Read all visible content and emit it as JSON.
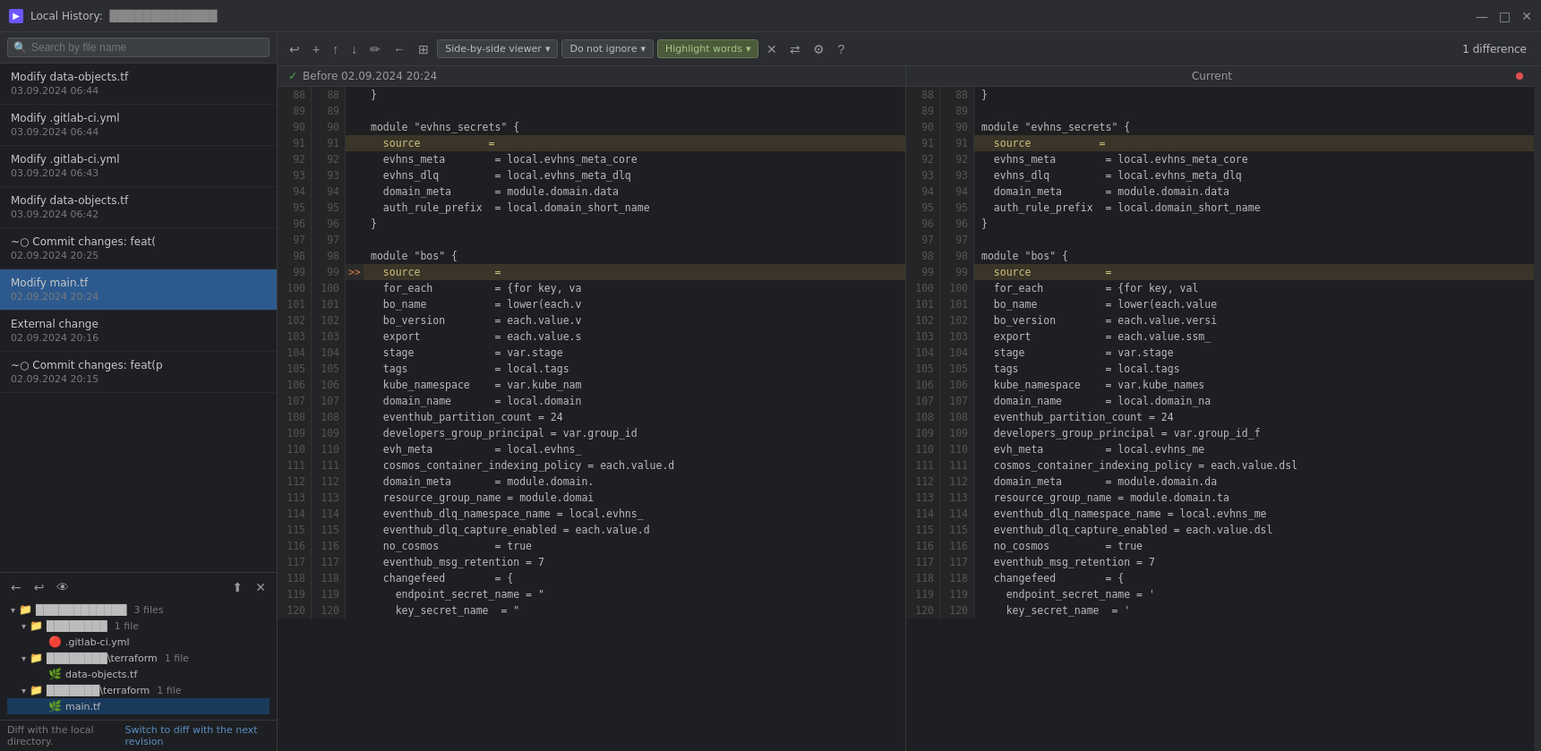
{
  "titleBar": {
    "icon": "▶",
    "title": "Local History:",
    "projectName": "█████████████",
    "windowControls": [
      "—",
      "□",
      "✕"
    ]
  },
  "search": {
    "placeholder": "Search by file name"
  },
  "historyItems": [
    {
      "id": 1,
      "title": "Modify data-objects.tf",
      "date": "03.09.2024 06:44"
    },
    {
      "id": 2,
      "title": "Modify .gitlab-ci.yml",
      "date": "03.09.2024 06:44"
    },
    {
      "id": 3,
      "title": "Modify .gitlab-ci.yml",
      "date": "03.09.2024 06:43"
    },
    {
      "id": 4,
      "title": "Modify data-objects.tf",
      "date": "03.09.2024 06:42"
    },
    {
      "id": 5,
      "title": "~○ Commit changes: feat(",
      "date": "02.09.2024 20:25",
      "hasHash": true
    },
    {
      "id": 6,
      "title": "Modify main.tf",
      "date": "02.09.2024 20:24",
      "selected": true
    },
    {
      "id": 7,
      "title": "External change",
      "date": "02.09.2024 20:16"
    },
    {
      "id": 8,
      "title": "~○ Commit changes: feat(p",
      "date": "02.09.2024 20:15",
      "hasHash": true
    }
  ],
  "treeItems": [
    {
      "id": 1,
      "label": "████████████",
      "count": "3 files",
      "indent": 0,
      "type": "folder",
      "expanded": true
    },
    {
      "id": 2,
      "label": "████████",
      "count": "1 file",
      "indent": 1,
      "type": "folder",
      "expanded": true
    },
    {
      "id": 3,
      "label": ".gitlab-ci.yml",
      "count": "",
      "indent": 2,
      "type": "yaml"
    },
    {
      "id": 4,
      "label": "████████\\terraform",
      "count": "1 file",
      "indent": 1,
      "type": "folder",
      "expanded": true
    },
    {
      "id": 5,
      "label": "data-objects.tf",
      "count": "",
      "indent": 2,
      "type": "tf"
    },
    {
      "id": 6,
      "label": "███████\\terraform",
      "count": "1 file",
      "indent": 1,
      "type": "folder",
      "expanded": true
    },
    {
      "id": 7,
      "label": "main.tf",
      "count": "",
      "indent": 2,
      "type": "tf",
      "selected": true
    }
  ],
  "diffFooter": {
    "text": "Diff with the local directory.",
    "linkText": "Switch to diff with the next revision"
  },
  "toolbar": {
    "diffCount": "1 difference",
    "viewerMode": "Side-by-side viewer",
    "ignoreMode": "Do not ignore",
    "highlightMode": "Highlight words"
  },
  "leftPane": {
    "header": "Before 02.09.2024 20:24"
  },
  "rightPane": {
    "header": "Current"
  },
  "codeLines": [
    {
      "num": 88,
      "content": "}"
    },
    {
      "num": 89,
      "content": ""
    },
    {
      "num": 90,
      "content": "module \"evhns_secrets\" {",
      "modified": false
    },
    {
      "num": 91,
      "content": "  source           =",
      "modified": true,
      "highlight": true
    },
    {
      "num": 92,
      "content": "  evhns_meta        = local.evhns_meta_core"
    },
    {
      "num": 93,
      "content": "  evhns_dlq         = local.evhns_meta_dlq"
    },
    {
      "num": 94,
      "content": "  domain_meta       = module.domain.data"
    },
    {
      "num": 95,
      "content": "  auth_rule_prefix  = local.domain_short_name"
    },
    {
      "num": 96,
      "content": "}"
    },
    {
      "num": 97,
      "content": ""
    },
    {
      "num": 98,
      "content": "module \"bos\" {"
    },
    {
      "num": 99,
      "content": "  source            =",
      "modified": true,
      "arrow": true
    },
    {
      "num": 100,
      "content": "  for_each          = {for key, va"
    },
    {
      "num": 101,
      "content": "  bo_name           = lower(each.v"
    },
    {
      "num": 102,
      "content": "  bo_version        = each.value.v"
    },
    {
      "num": 103,
      "content": "  export            = each.value.s"
    },
    {
      "num": 104,
      "content": "  stage             = var.stage"
    },
    {
      "num": 105,
      "content": "  tags              = local.tags"
    },
    {
      "num": 106,
      "content": "  kube_namespace    = var.kube_nam"
    },
    {
      "num": 107,
      "content": "  domain_name       = local.domain"
    },
    {
      "num": 108,
      "content": "  eventhub_partition_count = 24"
    },
    {
      "num": 109,
      "content": "  developers_group_principal = var.group_id"
    },
    {
      "num": 110,
      "content": "  evh_meta          = local.evhns_"
    },
    {
      "num": 111,
      "content": "  cosmos_container_indexing_policy = each.value.d"
    },
    {
      "num": 112,
      "content": "  domain_meta       = module.domain."
    },
    {
      "num": 113,
      "content": "  resource_group_name = module.domai"
    },
    {
      "num": 114,
      "content": "  eventhub_dlq_namespace_name = local.evhns_"
    },
    {
      "num": 115,
      "content": "  eventhub_dlq_capture_enabled = each.value.d"
    },
    {
      "num": 116,
      "content": "  no_cosmos         = true"
    },
    {
      "num": 117,
      "content": "  eventhub_msg_retention = 7"
    },
    {
      "num": 118,
      "content": "  changefeed        = {"
    },
    {
      "num": 119,
      "content": "    endpoint_secret_name = \""
    },
    {
      "num": 120,
      "content": "    key_secret_name  = \""
    }
  ],
  "rightCodeLines": [
    {
      "num": 88,
      "content": "}"
    },
    {
      "num": 89,
      "content": ""
    },
    {
      "num": 90,
      "content": "module \"evhns_secrets\" {"
    },
    {
      "num": 91,
      "content": "  source           =",
      "modified": true
    },
    {
      "num": 92,
      "content": "  evhns_meta        = local.evhns_meta_core"
    },
    {
      "num": 93,
      "content": "  evhns_dlq         = local.evhns_meta_dlq"
    },
    {
      "num": 94,
      "content": "  domain_meta       = module.domain.data"
    },
    {
      "num": 95,
      "content": "  auth_rule_prefix  = local.domain_short_name"
    },
    {
      "num": 96,
      "content": "}"
    },
    {
      "num": 97,
      "content": ""
    },
    {
      "num": 98,
      "content": "module \"bos\" {"
    },
    {
      "num": 99,
      "content": "  source            =",
      "modified": true
    },
    {
      "num": 100,
      "content": "  for_each          = {for key, val"
    },
    {
      "num": 101,
      "content": "  bo_name           = lower(each.value"
    },
    {
      "num": 102,
      "content": "  bo_version        = each.value.versi"
    },
    {
      "num": 103,
      "content": "  export            = each.value.ssm_"
    },
    {
      "num": 104,
      "content": "  stage             = var.stage"
    },
    {
      "num": 105,
      "content": "  tags              = local.tags"
    },
    {
      "num": 106,
      "content": "  kube_namespace    = var.kube_names"
    },
    {
      "num": 107,
      "content": "  domain_name       = local.domain_na"
    },
    {
      "num": 108,
      "content": "  eventhub_partition_count = 24"
    },
    {
      "num": 109,
      "content": "  developers_group_principal = var.group_id_f"
    },
    {
      "num": 110,
      "content": "  evh_meta          = local.evhns_me"
    },
    {
      "num": 111,
      "content": "  cosmos_container_indexing_policy = each.value.dsl"
    },
    {
      "num": 112,
      "content": "  domain_meta       = module.domain.da"
    },
    {
      "num": 113,
      "content": "  resource_group_name = module.domain.ta"
    },
    {
      "num": 114,
      "content": "  eventhub_dlq_namespace_name = local.evhns_me"
    },
    {
      "num": 115,
      "content": "  eventhub_dlq_capture_enabled = each.value.dsl"
    },
    {
      "num": 116,
      "content": "  no_cosmos         = true"
    },
    {
      "num": 117,
      "content": "  eventhub_msg_retention = 7"
    },
    {
      "num": 118,
      "content": "  changefeed        = {"
    },
    {
      "num": 119,
      "content": "    endpoint_secret_name = '"
    },
    {
      "num": 120,
      "content": "    key_secret_name  = '"
    }
  ]
}
